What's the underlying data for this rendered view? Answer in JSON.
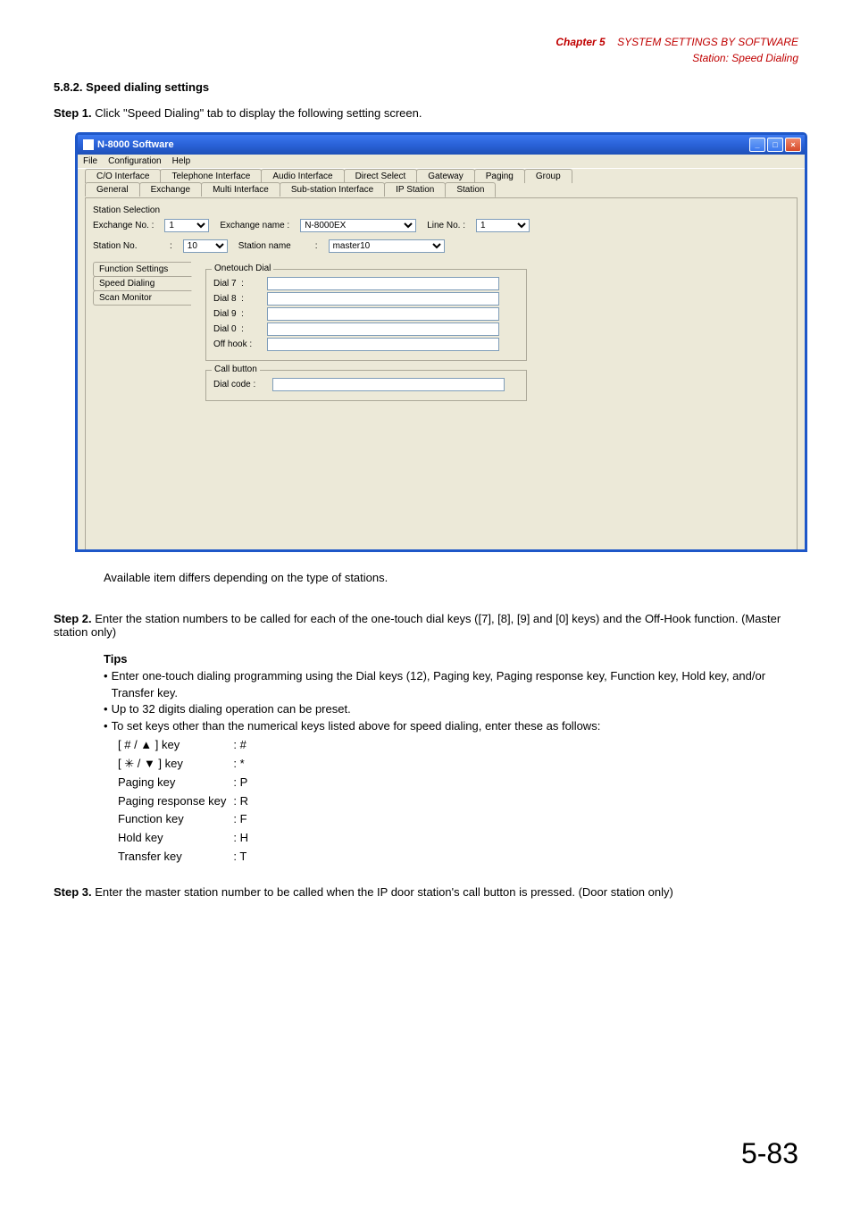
{
  "header": {
    "chapter": "Chapter 5",
    "title": "SYSTEM SETTINGS BY SOFTWARE",
    "subtitle": "Station: Speed Dialing"
  },
  "section": {
    "number": "5.8.2.",
    "title": "Speed dialing settings"
  },
  "steps": {
    "s1": {
      "label": "Step 1.",
      "text": "Click \"Speed Dialing\" tab to display the following setting screen."
    },
    "s2": {
      "label": "Step 2.",
      "text": "Enter the station numbers to be called for each of the one-touch dial keys ([7], [8], [9] and [0] keys) and the Off-Hook function. (Master station only)"
    },
    "s3": {
      "label": "Step 3.",
      "text": "Enter the master station number to be called when the IP door station's call button is pressed. (Door station only)"
    }
  },
  "note": "Available item differs depending on the type of stations.",
  "tips": {
    "heading": "Tips",
    "b1": "Enter one-touch dialing programming using the Dial keys (12), Paging key, Paging response key, Function key, Hold key, and/or Transfer key.",
    "b2": "Up to 32 digits dialing operation can be preset.",
    "b3": "To set keys other than the numerical keys listed above for speed dialing, enter these as follows:",
    "rows": [
      {
        "k": "[ # / ▲ ] key",
        "v": ": #"
      },
      {
        "k": "[ ✳ / ▼ ] key",
        "v": ": *"
      },
      {
        "k": "Paging key",
        "v": ": P"
      },
      {
        "k": "Paging response key",
        "v": ": R"
      },
      {
        "k": "Function key",
        "v": ": F"
      },
      {
        "k": "Hold key",
        "v": ": H"
      },
      {
        "k": "Transfer key",
        "v": ": T"
      }
    ]
  },
  "window": {
    "title": "N-8000 Software",
    "menu": {
      "file": "File",
      "config": "Configuration",
      "help": "Help"
    },
    "tabs_back": [
      "C/O Interface",
      "Telephone Interface",
      "Audio Interface",
      "Direct Select",
      "Gateway",
      "Paging",
      "Group"
    ],
    "tabs_front": [
      "General",
      "Exchange",
      "Multi Interface",
      "Sub-station Interface",
      "IP Station",
      "Station"
    ],
    "station_selection": {
      "title": "Station Selection",
      "ex_no_lbl": "Exchange No. :",
      "ex_no_val": "1",
      "ex_name_lbl": "Exchange name :",
      "ex_name_val": "N-8000EX",
      "line_no_lbl": "Line No. :",
      "line_no_val": "1",
      "st_no_lbl": "Station No.",
      "st_no_colon": ":",
      "st_no_val": "10",
      "st_name_lbl": "Station name",
      "st_name_colon": ":",
      "st_name_val": "master10"
    },
    "side_tabs": {
      "func": "Function Settings",
      "speed": "Speed Dialing",
      "scan": "Scan Monitor"
    },
    "onetouch": {
      "legend": "Onetouch Dial",
      "d7": "Dial 7",
      "d8": "Dial 8",
      "d9": "Dial 9",
      "d0": "Dial 0",
      "off": "Off hook :",
      "colon": ":"
    },
    "callbtn": {
      "legend": "Call button",
      "dial_code": "Dial code :"
    }
  },
  "page_number": "5-83"
}
